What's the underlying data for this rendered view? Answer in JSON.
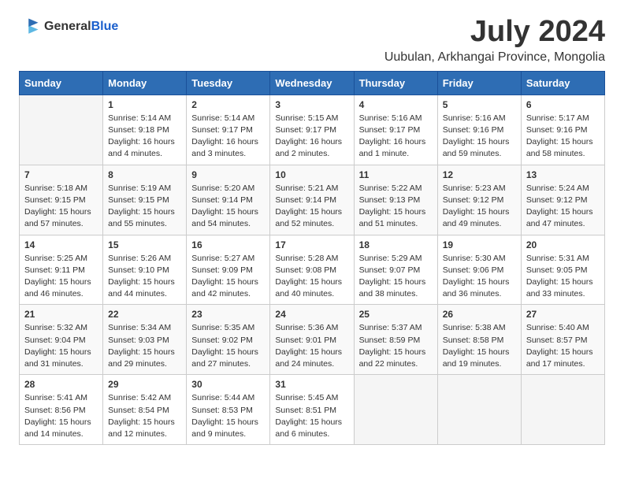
{
  "header": {
    "logo": {
      "general": "General",
      "blue": "Blue"
    },
    "title": "July 2024",
    "subtitle": "Uubulan, Arkhangai Province, Mongolia"
  },
  "calendar": {
    "days_of_week": [
      "Sunday",
      "Monday",
      "Tuesday",
      "Wednesday",
      "Thursday",
      "Friday",
      "Saturday"
    ],
    "weeks": [
      [
        {
          "day": "",
          "info": ""
        },
        {
          "day": "1",
          "info": "Sunrise: 5:14 AM\nSunset: 9:18 PM\nDaylight: 16 hours\nand 4 minutes."
        },
        {
          "day": "2",
          "info": "Sunrise: 5:14 AM\nSunset: 9:17 PM\nDaylight: 16 hours\nand 3 minutes."
        },
        {
          "day": "3",
          "info": "Sunrise: 5:15 AM\nSunset: 9:17 PM\nDaylight: 16 hours\nand 2 minutes."
        },
        {
          "day": "4",
          "info": "Sunrise: 5:16 AM\nSunset: 9:17 PM\nDaylight: 16 hours\nand 1 minute."
        },
        {
          "day": "5",
          "info": "Sunrise: 5:16 AM\nSunset: 9:16 PM\nDaylight: 15 hours\nand 59 minutes."
        },
        {
          "day": "6",
          "info": "Sunrise: 5:17 AM\nSunset: 9:16 PM\nDaylight: 15 hours\nand 58 minutes."
        }
      ],
      [
        {
          "day": "7",
          "info": "Sunrise: 5:18 AM\nSunset: 9:15 PM\nDaylight: 15 hours\nand 57 minutes."
        },
        {
          "day": "8",
          "info": "Sunrise: 5:19 AM\nSunset: 9:15 PM\nDaylight: 15 hours\nand 55 minutes."
        },
        {
          "day": "9",
          "info": "Sunrise: 5:20 AM\nSunset: 9:14 PM\nDaylight: 15 hours\nand 54 minutes."
        },
        {
          "day": "10",
          "info": "Sunrise: 5:21 AM\nSunset: 9:14 PM\nDaylight: 15 hours\nand 52 minutes."
        },
        {
          "day": "11",
          "info": "Sunrise: 5:22 AM\nSunset: 9:13 PM\nDaylight: 15 hours\nand 51 minutes."
        },
        {
          "day": "12",
          "info": "Sunrise: 5:23 AM\nSunset: 9:12 PM\nDaylight: 15 hours\nand 49 minutes."
        },
        {
          "day": "13",
          "info": "Sunrise: 5:24 AM\nSunset: 9:12 PM\nDaylight: 15 hours\nand 47 minutes."
        }
      ],
      [
        {
          "day": "14",
          "info": "Sunrise: 5:25 AM\nSunset: 9:11 PM\nDaylight: 15 hours\nand 46 minutes."
        },
        {
          "day": "15",
          "info": "Sunrise: 5:26 AM\nSunset: 9:10 PM\nDaylight: 15 hours\nand 44 minutes."
        },
        {
          "day": "16",
          "info": "Sunrise: 5:27 AM\nSunset: 9:09 PM\nDaylight: 15 hours\nand 42 minutes."
        },
        {
          "day": "17",
          "info": "Sunrise: 5:28 AM\nSunset: 9:08 PM\nDaylight: 15 hours\nand 40 minutes."
        },
        {
          "day": "18",
          "info": "Sunrise: 5:29 AM\nSunset: 9:07 PM\nDaylight: 15 hours\nand 38 minutes."
        },
        {
          "day": "19",
          "info": "Sunrise: 5:30 AM\nSunset: 9:06 PM\nDaylight: 15 hours\nand 36 minutes."
        },
        {
          "day": "20",
          "info": "Sunrise: 5:31 AM\nSunset: 9:05 PM\nDaylight: 15 hours\nand 33 minutes."
        }
      ],
      [
        {
          "day": "21",
          "info": "Sunrise: 5:32 AM\nSunset: 9:04 PM\nDaylight: 15 hours\nand 31 minutes."
        },
        {
          "day": "22",
          "info": "Sunrise: 5:34 AM\nSunset: 9:03 PM\nDaylight: 15 hours\nand 29 minutes."
        },
        {
          "day": "23",
          "info": "Sunrise: 5:35 AM\nSunset: 9:02 PM\nDaylight: 15 hours\nand 27 minutes."
        },
        {
          "day": "24",
          "info": "Sunrise: 5:36 AM\nSunset: 9:01 PM\nDaylight: 15 hours\nand 24 minutes."
        },
        {
          "day": "25",
          "info": "Sunrise: 5:37 AM\nSunset: 8:59 PM\nDaylight: 15 hours\nand 22 minutes."
        },
        {
          "day": "26",
          "info": "Sunrise: 5:38 AM\nSunset: 8:58 PM\nDaylight: 15 hours\nand 19 minutes."
        },
        {
          "day": "27",
          "info": "Sunrise: 5:40 AM\nSunset: 8:57 PM\nDaylight: 15 hours\nand 17 minutes."
        }
      ],
      [
        {
          "day": "28",
          "info": "Sunrise: 5:41 AM\nSunset: 8:56 PM\nDaylight: 15 hours\nand 14 minutes."
        },
        {
          "day": "29",
          "info": "Sunrise: 5:42 AM\nSunset: 8:54 PM\nDaylight: 15 hours\nand 12 minutes."
        },
        {
          "day": "30",
          "info": "Sunrise: 5:44 AM\nSunset: 8:53 PM\nDaylight: 15 hours\nand 9 minutes."
        },
        {
          "day": "31",
          "info": "Sunrise: 5:45 AM\nSunset: 8:51 PM\nDaylight: 15 hours\nand 6 minutes."
        },
        {
          "day": "",
          "info": ""
        },
        {
          "day": "",
          "info": ""
        },
        {
          "day": "",
          "info": ""
        }
      ]
    ]
  }
}
